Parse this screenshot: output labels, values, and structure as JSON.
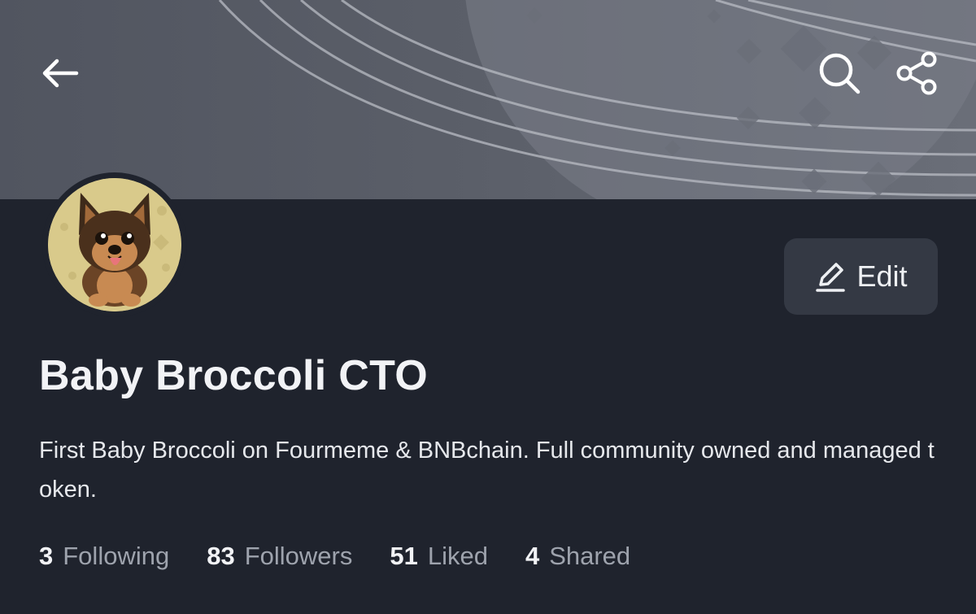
{
  "header": {
    "back_icon": "arrow-left-icon",
    "search_icon": "search-icon",
    "share_icon": "share-icon"
  },
  "profile": {
    "avatar": "dog-avatar",
    "name": "Baby Broccoli CTO",
    "bio": "First Baby Broccoli on Fourmeme & BNBchain. Full community owned and managed token.",
    "edit_label": "Edit",
    "edit_icon": "pencil-icon"
  },
  "stats": [
    {
      "value": "3",
      "label": "Following"
    },
    {
      "value": "83",
      "label": "Followers"
    },
    {
      "value": "51",
      "label": "Liked"
    },
    {
      "value": "4",
      "label": "Shared"
    }
  ],
  "colors": {
    "background": "#1f232d",
    "banner": "#5a5e68",
    "button": "#343944",
    "muted_text": "#9ea3ad"
  }
}
